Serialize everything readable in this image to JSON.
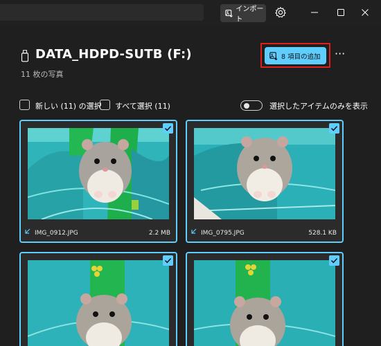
{
  "titlebar": {
    "import_label": "インポート",
    "icons": [
      "import-icon",
      "gear-icon",
      "minimize-icon",
      "maximize-icon",
      "close-icon"
    ]
  },
  "header": {
    "drive_title": "DATA_HDPD-SUTB (F:)",
    "photo_count": "11 枚の写真",
    "add_button_label": "8 項目の追加",
    "more_label": "···"
  },
  "selection": {
    "select_new_label": "新しい (11) の選択",
    "select_all_label": "すべて選択 (11)",
    "show_selected_label": "選択したアイテムのみを表示"
  },
  "photos": [
    {
      "filename": "IMG_0912.JPG",
      "size": "2.2 MB",
      "selected": true
    },
    {
      "filename": "IMG_0795.JPG",
      "size": "528.1 KB",
      "selected": true
    },
    {
      "filename": "",
      "size": "",
      "selected": true
    },
    {
      "filename": "",
      "size": "",
      "selected": true
    }
  ],
  "colors": {
    "accent": "#60cdff",
    "highlight_frame": "#e0201f",
    "background": "#1f1f1f",
    "card": "#2b2b2b"
  }
}
